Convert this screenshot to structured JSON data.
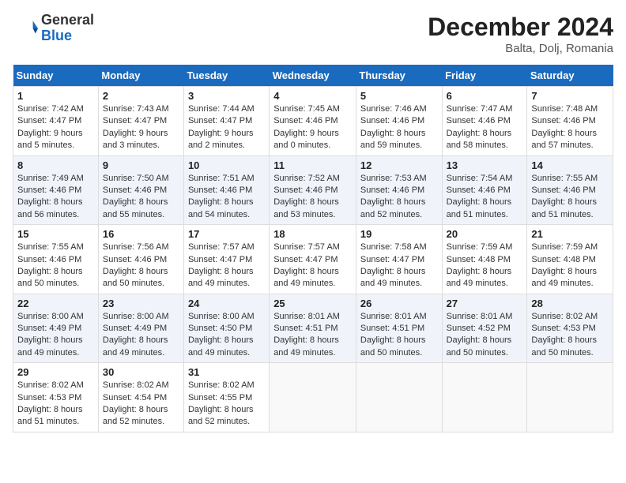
{
  "header": {
    "logo_general": "General",
    "logo_blue": "Blue",
    "month": "December 2024",
    "location": "Balta, Dolj, Romania"
  },
  "weekdays": [
    "Sunday",
    "Monday",
    "Tuesday",
    "Wednesday",
    "Thursday",
    "Friday",
    "Saturday"
  ],
  "weeks": [
    [
      {
        "day": 1,
        "info": "Sunrise: 7:42 AM\nSunset: 4:47 PM\nDaylight: 9 hours and 5 minutes."
      },
      {
        "day": 2,
        "info": "Sunrise: 7:43 AM\nSunset: 4:47 PM\nDaylight: 9 hours and 3 minutes."
      },
      {
        "day": 3,
        "info": "Sunrise: 7:44 AM\nSunset: 4:47 PM\nDaylight: 9 hours and 2 minutes."
      },
      {
        "day": 4,
        "info": "Sunrise: 7:45 AM\nSunset: 4:46 PM\nDaylight: 9 hours and 0 minutes."
      },
      {
        "day": 5,
        "info": "Sunrise: 7:46 AM\nSunset: 4:46 PM\nDaylight: 8 hours and 59 minutes."
      },
      {
        "day": 6,
        "info": "Sunrise: 7:47 AM\nSunset: 4:46 PM\nDaylight: 8 hours and 58 minutes."
      },
      {
        "day": 7,
        "info": "Sunrise: 7:48 AM\nSunset: 4:46 PM\nDaylight: 8 hours and 57 minutes."
      }
    ],
    [
      {
        "day": 8,
        "info": "Sunrise: 7:49 AM\nSunset: 4:46 PM\nDaylight: 8 hours and 56 minutes."
      },
      {
        "day": 9,
        "info": "Sunrise: 7:50 AM\nSunset: 4:46 PM\nDaylight: 8 hours and 55 minutes."
      },
      {
        "day": 10,
        "info": "Sunrise: 7:51 AM\nSunset: 4:46 PM\nDaylight: 8 hours and 54 minutes."
      },
      {
        "day": 11,
        "info": "Sunrise: 7:52 AM\nSunset: 4:46 PM\nDaylight: 8 hours and 53 minutes."
      },
      {
        "day": 12,
        "info": "Sunrise: 7:53 AM\nSunset: 4:46 PM\nDaylight: 8 hours and 52 minutes."
      },
      {
        "day": 13,
        "info": "Sunrise: 7:54 AM\nSunset: 4:46 PM\nDaylight: 8 hours and 51 minutes."
      },
      {
        "day": 14,
        "info": "Sunrise: 7:55 AM\nSunset: 4:46 PM\nDaylight: 8 hours and 51 minutes."
      }
    ],
    [
      {
        "day": 15,
        "info": "Sunrise: 7:55 AM\nSunset: 4:46 PM\nDaylight: 8 hours and 50 minutes."
      },
      {
        "day": 16,
        "info": "Sunrise: 7:56 AM\nSunset: 4:46 PM\nDaylight: 8 hours and 50 minutes."
      },
      {
        "day": 17,
        "info": "Sunrise: 7:57 AM\nSunset: 4:47 PM\nDaylight: 8 hours and 49 minutes."
      },
      {
        "day": 18,
        "info": "Sunrise: 7:57 AM\nSunset: 4:47 PM\nDaylight: 8 hours and 49 minutes."
      },
      {
        "day": 19,
        "info": "Sunrise: 7:58 AM\nSunset: 4:47 PM\nDaylight: 8 hours and 49 minutes."
      },
      {
        "day": 20,
        "info": "Sunrise: 7:59 AM\nSunset: 4:48 PM\nDaylight: 8 hours and 49 minutes."
      },
      {
        "day": 21,
        "info": "Sunrise: 7:59 AM\nSunset: 4:48 PM\nDaylight: 8 hours and 49 minutes."
      }
    ],
    [
      {
        "day": 22,
        "info": "Sunrise: 8:00 AM\nSunset: 4:49 PM\nDaylight: 8 hours and 49 minutes."
      },
      {
        "day": 23,
        "info": "Sunrise: 8:00 AM\nSunset: 4:49 PM\nDaylight: 8 hours and 49 minutes."
      },
      {
        "day": 24,
        "info": "Sunrise: 8:00 AM\nSunset: 4:50 PM\nDaylight: 8 hours and 49 minutes."
      },
      {
        "day": 25,
        "info": "Sunrise: 8:01 AM\nSunset: 4:51 PM\nDaylight: 8 hours and 49 minutes."
      },
      {
        "day": 26,
        "info": "Sunrise: 8:01 AM\nSunset: 4:51 PM\nDaylight: 8 hours and 50 minutes."
      },
      {
        "day": 27,
        "info": "Sunrise: 8:01 AM\nSunset: 4:52 PM\nDaylight: 8 hours and 50 minutes."
      },
      {
        "day": 28,
        "info": "Sunrise: 8:02 AM\nSunset: 4:53 PM\nDaylight: 8 hours and 50 minutes."
      }
    ],
    [
      {
        "day": 29,
        "info": "Sunrise: 8:02 AM\nSunset: 4:53 PM\nDaylight: 8 hours and 51 minutes."
      },
      {
        "day": 30,
        "info": "Sunrise: 8:02 AM\nSunset: 4:54 PM\nDaylight: 8 hours and 52 minutes."
      },
      {
        "day": 31,
        "info": "Sunrise: 8:02 AM\nSunset: 4:55 PM\nDaylight: 8 hours and 52 minutes."
      },
      null,
      null,
      null,
      null
    ]
  ]
}
